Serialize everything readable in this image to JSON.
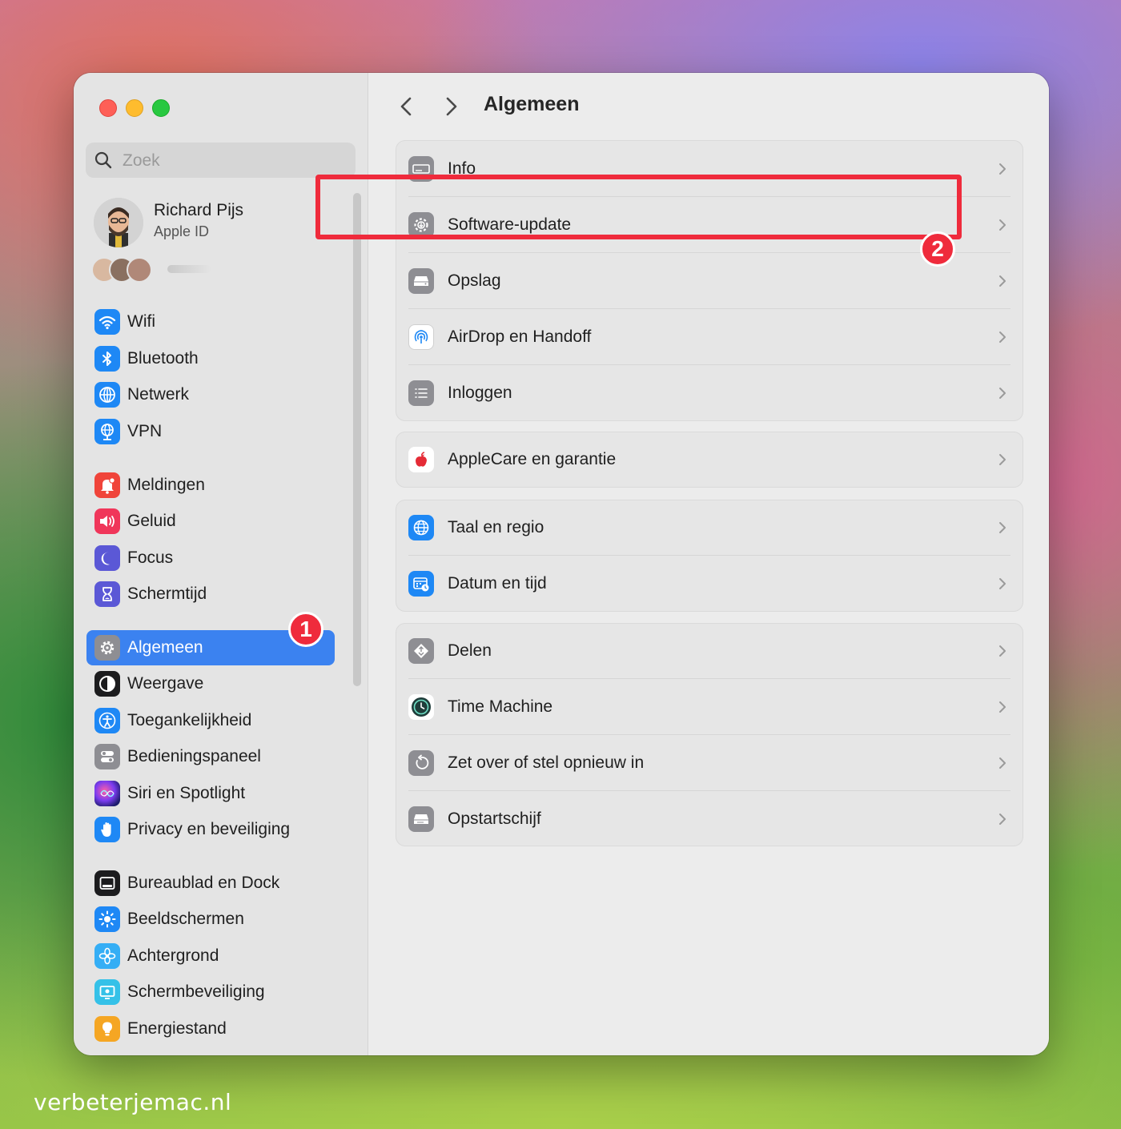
{
  "window": {
    "search": {
      "placeholder": "Zoek"
    },
    "profile": {
      "name": "Richard Pijs",
      "subtitle": "Apple ID"
    }
  },
  "sidebar": {
    "items": [
      {
        "label": "Wifi",
        "icon": "wifi-icon",
        "color": "#1e88f5"
      },
      {
        "label": "Bluetooth",
        "icon": "bluetooth-icon",
        "color": "#1e88f5"
      },
      {
        "label": "Netwerk",
        "icon": "globe-icon",
        "color": "#1e88f5"
      },
      {
        "label": "VPN",
        "icon": "vpn-globe-icon",
        "color": "#1e88f5"
      },
      {
        "label": "Meldingen",
        "icon": "bell-icon",
        "color": "#f0443a"
      },
      {
        "label": "Geluid",
        "icon": "speaker-icon",
        "color": "#f0365a"
      },
      {
        "label": "Focus",
        "icon": "moon-icon",
        "color": "#5b58d6"
      },
      {
        "label": "Schermtijd",
        "icon": "hourglass-icon",
        "color": "#5b58d6"
      },
      {
        "label": "Algemeen",
        "icon": "gear-icon",
        "color": "#8e8e93",
        "selected": true
      },
      {
        "label": "Weergave",
        "icon": "appearance-icon",
        "color": "#1c1c1e"
      },
      {
        "label": "Toegankelijkheid",
        "icon": "accessibility-icon",
        "color": "#1e88f5"
      },
      {
        "label": "Bedieningspaneel",
        "icon": "control-center-icon",
        "color": "#8e8e93"
      },
      {
        "label": "Siri en Spotlight",
        "icon": "siri-icon",
        "color": "#6a3ad6"
      },
      {
        "label": "Privacy en beveiliging",
        "icon": "hand-icon",
        "color": "#1e88f5"
      },
      {
        "label": "Bureaublad en Dock",
        "icon": "dock-icon",
        "color": "#1c1c1e"
      },
      {
        "label": "Beeldschermen",
        "icon": "sun-icon",
        "color": "#1e88f5"
      },
      {
        "label": "Achtergrond",
        "icon": "flower-icon",
        "color": "#35aef5"
      },
      {
        "label": "Schermbeveiliging",
        "icon": "screensaver-icon",
        "color": "#35c1e8"
      },
      {
        "label": "Energiestand",
        "icon": "lightbulb-icon",
        "color": "#f5a623"
      }
    ]
  },
  "main": {
    "title": "Algemeen",
    "groups": [
      {
        "rows": [
          {
            "label": "Info",
            "icon": "info-laptop-icon"
          },
          {
            "label": "Software-update",
            "icon": "software-update-gear-icon"
          },
          {
            "label": "Opslag",
            "icon": "storage-drive-icon"
          },
          {
            "label": "AirDrop en Handoff",
            "icon": "airdrop-icon"
          },
          {
            "label": "Inloggen",
            "icon": "login-list-icon"
          }
        ]
      },
      {
        "rows": [
          {
            "label": "AppleCare en garantie",
            "icon": "apple-logo-icon"
          }
        ]
      },
      {
        "rows": [
          {
            "label": "Taal en regio",
            "icon": "language-globe-icon"
          },
          {
            "label": "Datum en tijd",
            "icon": "calendar-clock-icon"
          }
        ]
      },
      {
        "rows": [
          {
            "label": "Delen",
            "icon": "sharing-icon"
          },
          {
            "label": "Time Machine",
            "icon": "time-machine-icon"
          },
          {
            "label": "Zet over of stel opnieuw in",
            "icon": "reset-icon"
          },
          {
            "label": "Opstartschijf",
            "icon": "startup-disk-icon"
          }
        ]
      }
    ]
  },
  "annotations": {
    "badge_1": "1",
    "badge_2": "2"
  },
  "watermark": "verbeterjemac.nl"
}
